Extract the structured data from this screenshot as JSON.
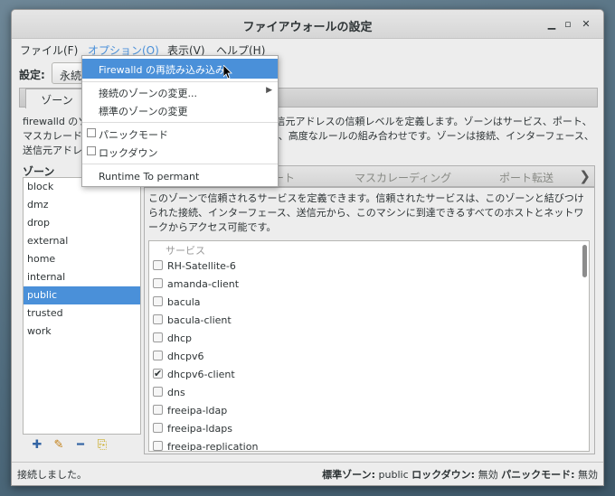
{
  "window": {
    "title": "ファイアウォールの設定"
  },
  "menubar": {
    "items": [
      {
        "label": "ファイル(F)",
        "active": false
      },
      {
        "label": "オプション(O)",
        "active": true
      },
      {
        "label": "表示(V)",
        "active": false
      },
      {
        "label": "ヘルプ(H)",
        "active": false
      }
    ]
  },
  "toolbar": {
    "config_label": "設定:",
    "config_value": "永続"
  },
  "zone_tabs": {
    "zone": "ゾーン"
  },
  "zone_desc": "firewalld のゾーンは、接続、インターフェースおよび送信元アドレスの信頼レベルを定義します。ゾーンはサービス、ポート、マスカレード、ポート・パケット転送、ICMP フィルター、高度なルールの組み合わせです。ゾーンは接続、インターフェース、送信元アドレスを結びつけられます。",
  "zones_label": "ゾーン",
  "zones": [
    "block",
    "dmz",
    "drop",
    "external",
    "home",
    "internal",
    "public",
    "trusted",
    "work"
  ],
  "selected_zone": "public",
  "zone_buttons": [
    "add-icon",
    "edit-icon",
    "remove-icon",
    "load-defaults-icon"
  ],
  "sub_tabs": [
    "ポート",
    "マスカレーディング",
    "ポート転送"
  ],
  "services": {
    "desc": "このゾーンで信頼されるサービスを定義できます。信頼されたサービスは、このゾーンと結びつけられた接続、インターフェース、送信元から、このマシンに到達できるすべてのホストとネットワークからアクセス可能です。",
    "header": "サービス",
    "items": [
      {
        "name": "RH-Satellite-6",
        "checked": false
      },
      {
        "name": "amanda-client",
        "checked": false
      },
      {
        "name": "bacula",
        "checked": false
      },
      {
        "name": "bacula-client",
        "checked": false
      },
      {
        "name": "dhcp",
        "checked": false
      },
      {
        "name": "dhcpv6",
        "checked": false
      },
      {
        "name": "dhcpv6-client",
        "checked": true
      },
      {
        "name": "dns",
        "checked": false
      },
      {
        "name": "freeipa-ldap",
        "checked": false
      },
      {
        "name": "freeipa-ldaps",
        "checked": false
      },
      {
        "name": "freeipa-replication",
        "checked": false
      }
    ]
  },
  "status": {
    "left": "接続しました。",
    "default_zone_label": "標準ゾーン:",
    "default_zone_value": "public",
    "lockdown_label": "ロックダウン:",
    "lockdown_value": "無効",
    "panic_label": "パニックモード:",
    "panic_value": "無効"
  },
  "dropdown": {
    "reload": "Firewalld の再読み込み込み",
    "change_conn_zone": "接続のゾーンの変更...",
    "change_default_zone": "標準のゾーンの変更",
    "panic_mode": "パニックモード",
    "lockdown": "ロックダウン",
    "runtime_to_permanent": "Runtime To permant"
  }
}
